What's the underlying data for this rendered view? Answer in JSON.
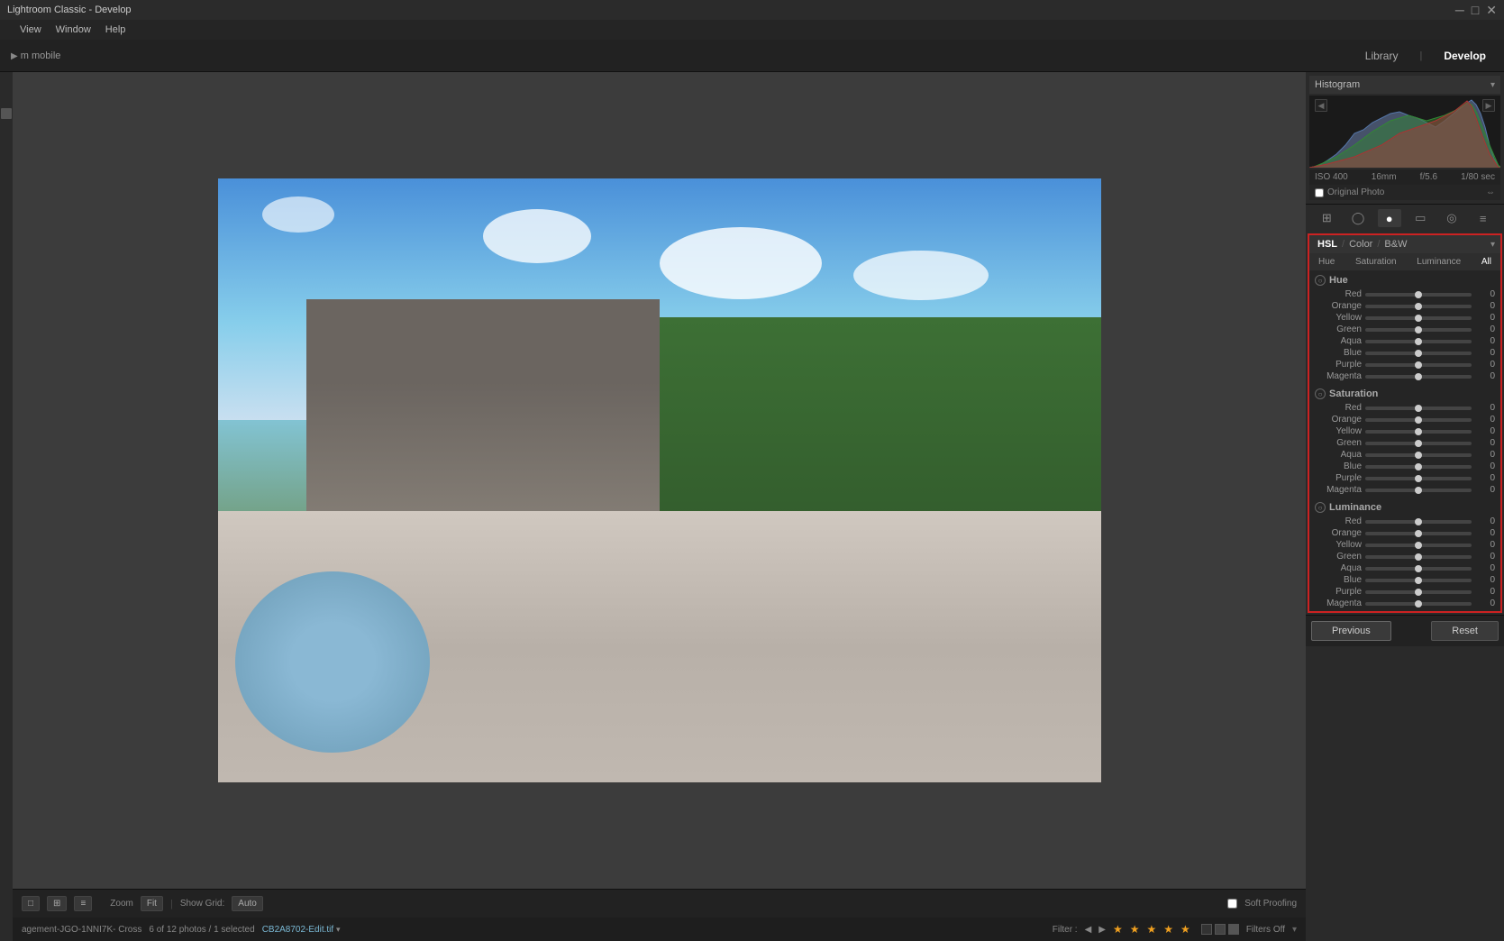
{
  "titlebar": {
    "title": "Lightroom Classic - Develop",
    "min": "─",
    "max": "□",
    "close": "✕"
  },
  "menubar": {
    "items": [
      "",
      "View",
      "Window",
      "Help"
    ]
  },
  "topPanel": {
    "appName": "m mobile",
    "navItems": [
      "Library",
      "Develop"
    ],
    "activeNav": "Develop"
  },
  "histogram": {
    "label": "Histogram",
    "exif": {
      "iso": "ISO 400",
      "lens": "16mm",
      "aperture": "f/5.6",
      "shutter": "1/80 sec"
    },
    "originalPhoto": "Original Photo"
  },
  "tools": {
    "icons": [
      "⊞",
      "◯",
      "●",
      "▭",
      "◎",
      "≡"
    ]
  },
  "hslPanel": {
    "title": "HSL",
    "tabs": [
      "HSL",
      "Color",
      "B&W"
    ],
    "subTabs": [
      "Hue",
      "Saturation",
      "Luminance",
      "All"
    ],
    "activeSubTab": "All",
    "hueSection": {
      "label": "Hue",
      "rows": [
        {
          "name": "Red",
          "value": "0"
        },
        {
          "name": "Orange",
          "value": "0"
        },
        {
          "name": "Yellow",
          "value": "0"
        },
        {
          "name": "Green",
          "value": "0"
        },
        {
          "name": "Aqua",
          "value": "0"
        },
        {
          "name": "Blue",
          "value": "0"
        },
        {
          "name": "Purple",
          "value": "0"
        },
        {
          "name": "Magenta",
          "value": "0"
        }
      ]
    },
    "satSection": {
      "label": "Saturation",
      "rows": [
        {
          "name": "Red",
          "value": "0"
        },
        {
          "name": "Orange",
          "value": "0"
        },
        {
          "name": "Yellow",
          "value": "0"
        },
        {
          "name": "Green",
          "value": "0"
        },
        {
          "name": "Aqua",
          "value": "0"
        },
        {
          "name": "Blue",
          "value": "0"
        },
        {
          "name": "Purple",
          "value": "0"
        },
        {
          "name": "Magenta",
          "value": "0"
        }
      ]
    },
    "lumSection": {
      "label": "Luminance",
      "rows": [
        {
          "name": "Red",
          "value": "0"
        },
        {
          "name": "Orange",
          "value": "0"
        },
        {
          "name": "Yellow",
          "value": "0"
        },
        {
          "name": "Green",
          "value": "0"
        },
        {
          "name": "Aqua",
          "value": "0"
        },
        {
          "name": "Blue",
          "value": "0"
        },
        {
          "name": "Purple",
          "value": "0"
        },
        {
          "name": "Magenta",
          "value": "0"
        }
      ]
    }
  },
  "bottomNav": {
    "previous": "Previous",
    "reset": "Reset"
  },
  "statusbar": {
    "fileInfo": "agement-JGO-1NNI7K- Cross",
    "photoCount": "6 of 12 photos / 1 selected",
    "filename": "CB2A8702-Edit.tif",
    "filterLabel": "Filter :",
    "filtersOff": "Filters Off",
    "stars": "★★★★★"
  },
  "bottomToolbar": {
    "viewBtn": "□",
    "zoomLabel": "Zoom",
    "fit": "Fit",
    "showGridLabel": "Show Grid:",
    "autoLabel": "Auto",
    "softProofing": "Soft Proofing"
  }
}
